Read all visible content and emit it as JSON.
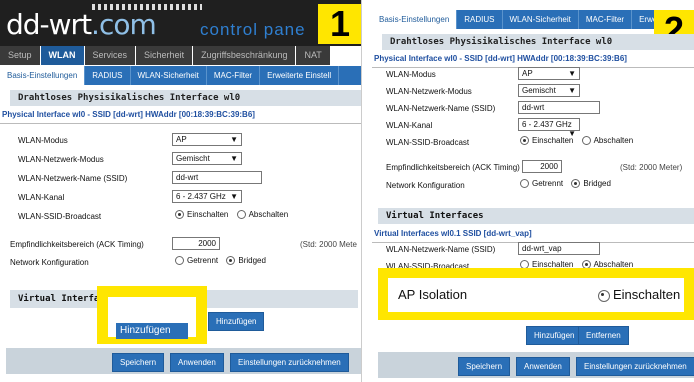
{
  "panel1": {
    "badge": "1",
    "logo": {
      "main": "dd-wrt",
      "tld": ".com",
      "tagline": "control pane"
    },
    "main_tabs": [
      "Setup",
      "WLAN",
      "Services",
      "Sicherheit",
      "Zugriffsbeschränkung",
      "NAT"
    ],
    "sub_tabs": [
      "Basis-Einstellungen",
      "RADIUS",
      "WLAN-Sicherheit",
      "MAC-Filter",
      "Erweiterte Einstell"
    ],
    "section_title": "Drahtloses Physisikalisches Interface wl0",
    "iface": "Physical Interface wl0 - SSID [dd-wrt] HWAddr [00:18:39:BC:39:B6]",
    "labels": {
      "mode": "WLAN-Modus",
      "netmode": "WLAN-Netzwerk-Modus",
      "ssid": "WLAN-Netzwerk-Name (SSID)",
      "channel": "WLAN-Kanal",
      "broadcast": "WLAN-SSID-Broadcast",
      "ack": "Empfindlichkeitsbereich (ACK Timing)",
      "netconf": "Network Konfiguration"
    },
    "values": {
      "mode": "AP",
      "netmode": "Gemischt",
      "ssid": "dd-wrt",
      "channel": "6 - 2.437 GHz",
      "ack": "2000",
      "ack_hint": "(Std: 2000 Mete"
    },
    "radios": {
      "on": "Einschalten",
      "off": "Abschalten",
      "sep": "Getrennt",
      "bridged": "Bridged"
    },
    "virtual_title": "Virtual Interfa",
    "add_ghost": "Hinzufügen",
    "add_btn": "Hinzufügen",
    "buttons": {
      "save": "Speichern",
      "apply": "Anwenden",
      "reset": "Einstellungen zurücknehmen"
    }
  },
  "panel2": {
    "badge": "2",
    "sub_tabs": [
      "Basis-Einstellungen",
      "RADIUS",
      "WLAN-Sicherheit",
      "MAC-Filter",
      "Erweiterte"
    ],
    "section_title": "Drahtloses Physisikalisches Interface wl0",
    "iface": "Physical Interface wl0 - SSID [dd-wrt] HWAddr [00:18:39:BC:39:B6]",
    "labels": {
      "mode": "WLAN-Modus",
      "netmode": "WLAN-Netzwerk-Modus",
      "ssid": "WLAN-Netzwerk-Name (SSID)",
      "channel": "WLAN-Kanal",
      "broadcast": "WLAN-SSID-Broadcast",
      "ack": "Empfindlichkeitsbereich (ACK Timing)",
      "netconf": "Network Konfiguration"
    },
    "values": {
      "mode": "AP",
      "netmode": "Gemischt",
      "ssid": "dd-wrt",
      "channel": "6 - 2.437 GHz",
      "ack": "2000",
      "ack_hint": "(Std: 2000 Meter)"
    },
    "radios": {
      "on": "Einschalten",
      "off": "Abschalten",
      "sep": "Getrennt",
      "bridged": "Bridged"
    },
    "virtual_title": "Virtual Interfaces",
    "viface": "Virtual Interfaces wl0.1 SSID [dd-wrt_vap]",
    "v_labels": {
      "ssid": "WLAN-Netzwerk-Name (SSID)",
      "broadcast": "WLAN-SSID-Broadcast"
    },
    "v_values": {
      "ssid": "dd-wrt_vap"
    },
    "ap_isolation": "AP Isolation",
    "ap_isolation_value": "Einschalten",
    "add_btn": "Hinzufügen",
    "remove_btn": "Entfernen",
    "buttons": {
      "save": "Speichern",
      "apply": "Anwenden",
      "reset": "Einstellungen zurücknehmen"
    }
  },
  "colors": {
    "accent": "#2a6fb7",
    "highlight": "#ffe600",
    "header": "#1f1f1f"
  }
}
